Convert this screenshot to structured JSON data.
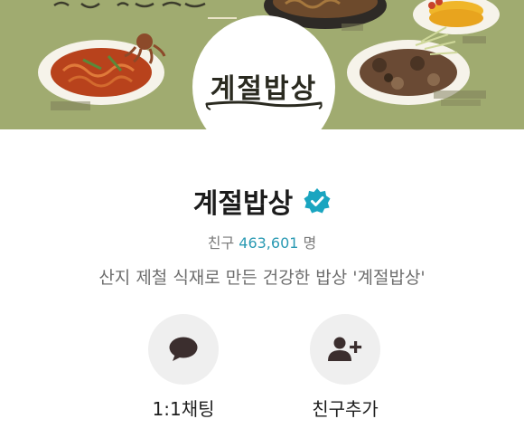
{
  "profile": {
    "logo_text": "계절밥상",
    "name": "계절밥상",
    "friends_label": "친구",
    "friends_count": "463,601",
    "friends_unit": "명",
    "description": "산지 제철 식재로 만든 건강한 밥상 '계절밥상'"
  },
  "actions": {
    "chat_label": "1:1채팅",
    "add_friend_label": "친구추가"
  },
  "colors": {
    "cover_background": "#9aa66a",
    "verified_badge": "#1aa5c0",
    "friends_count": "#2a9ab3",
    "action_circle": "#efefef",
    "action_icon": "#3b2e2e"
  },
  "icons": {
    "verified": "verified-badge-icon",
    "chat": "speech-bubble-icon",
    "add_friend": "add-person-icon"
  }
}
